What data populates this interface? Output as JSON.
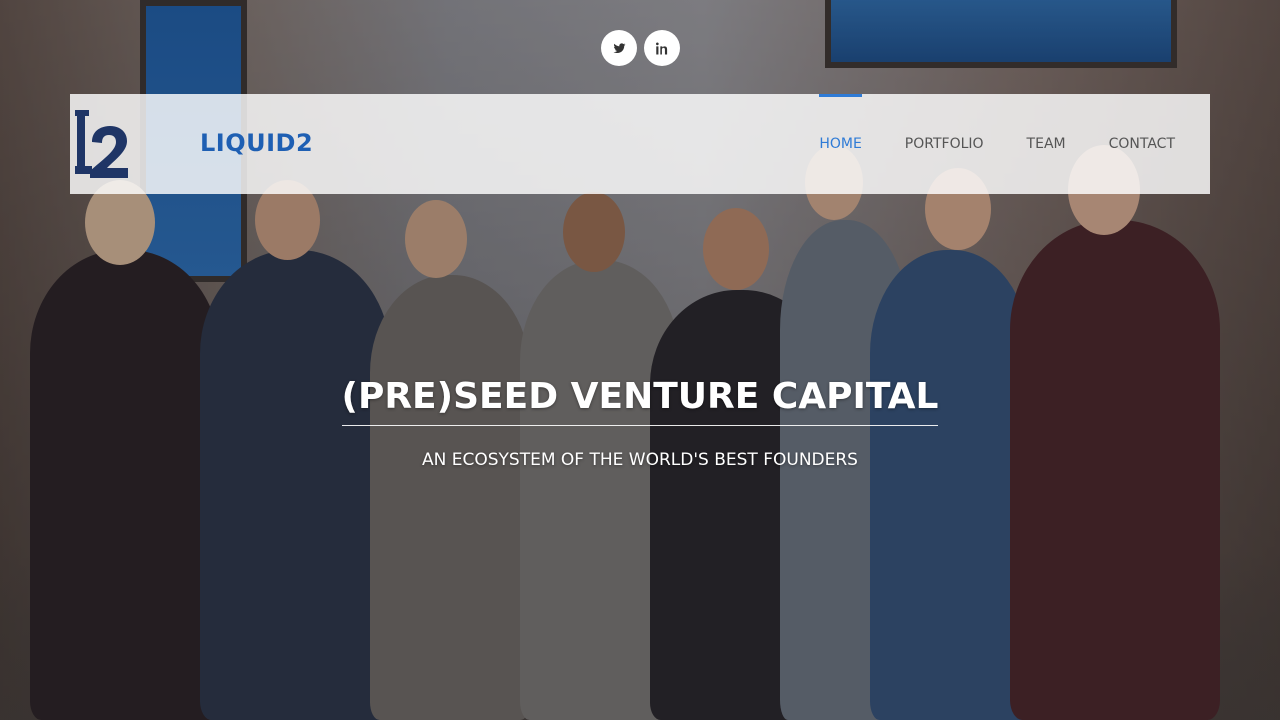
{
  "social": {
    "twitter_icon": "twitter-icon",
    "linkedin_icon": "linkedin-icon"
  },
  "brand": {
    "logo_text": "L2",
    "name": "LIQUID2",
    "color": "#1e5fb3"
  },
  "nav": {
    "items": [
      {
        "label": "HOME",
        "active": true
      },
      {
        "label": "PORTFOLIO",
        "active": false
      },
      {
        "label": "TEAM",
        "active": false
      },
      {
        "label": "CONTACT",
        "active": false
      }
    ],
    "active_color": "#2f7bd6"
  },
  "hero": {
    "title": "(PRE)SEED VENTURE CAPITAL",
    "subtitle": "AN ECOSYSTEM OF THE WORLD'S BEST FOUNDERS"
  }
}
